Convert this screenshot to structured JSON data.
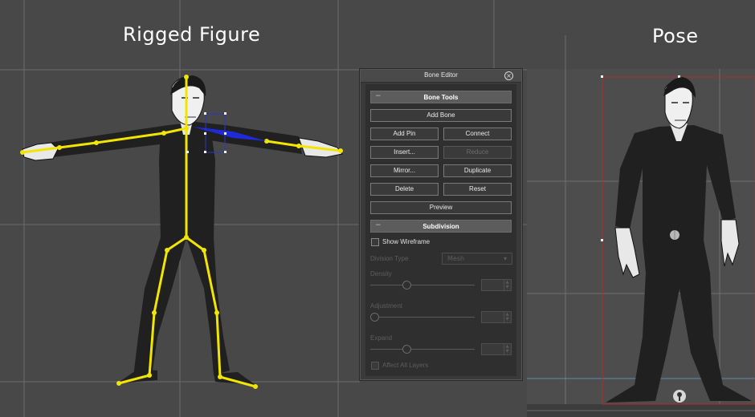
{
  "left_view": {
    "title": "Rigged Figure"
  },
  "right_view": {
    "title": "Pose"
  },
  "panel": {
    "title": "Bone Editor",
    "bone_tools": {
      "header": "Bone Tools",
      "add_bone": "Add Bone",
      "add_pin": "Add Pin",
      "connect": "Connect",
      "insert": "Insert...",
      "reduce": "Reduce",
      "mirror": "Mirror...",
      "duplicate": "Duplicate",
      "delete": "Delete",
      "reset": "Reset",
      "preview": "Preview"
    },
    "subdivision": {
      "header": "Subdivision",
      "show_wireframe": "Show Wireframe",
      "division_type_label": "Division Type",
      "division_type_value": "Mesh",
      "density_label": "Density",
      "adjustment_label": "Adjustment",
      "expand_label": "Expand",
      "affect_all_layers": "Affect All Layers"
    }
  },
  "colors": {
    "bone": "#f2e600",
    "selected_bone": "#1f2bd8",
    "bounding_box": "#b02a2a",
    "figure": "#202020",
    "background": "#484848"
  }
}
